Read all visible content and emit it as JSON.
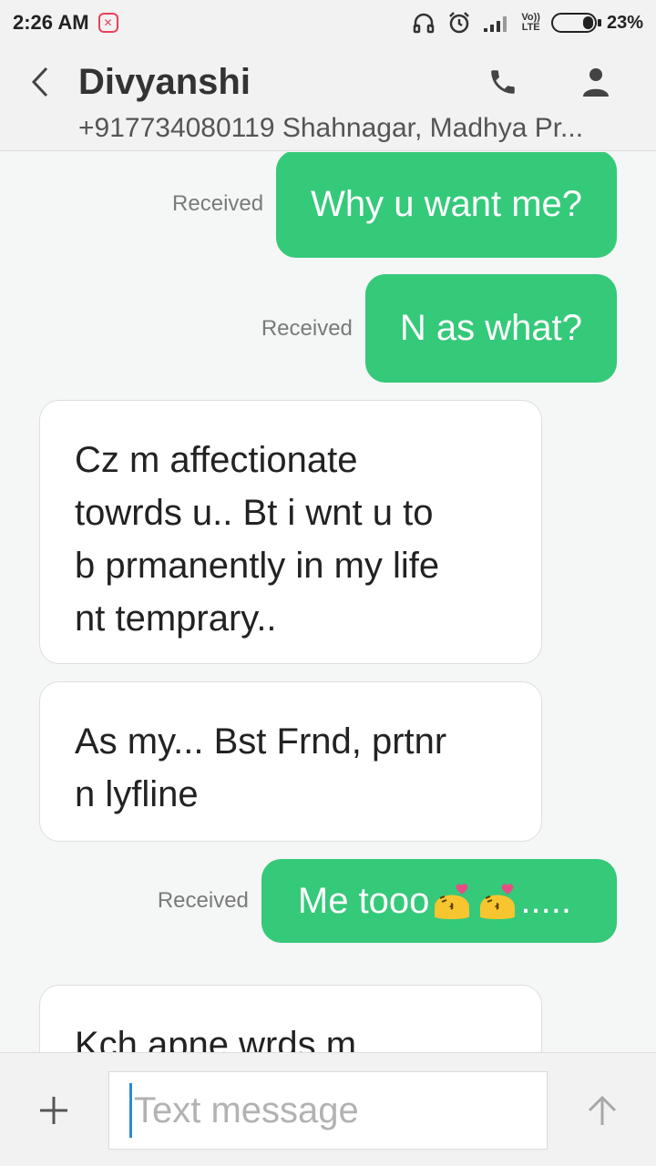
{
  "status_bar": {
    "time": "2:26 AM",
    "network": "VoLTE",
    "lte_top": "Vo))",
    "lte_bottom": "LTE",
    "battery_percent": "23%",
    "battery_level": 0.23
  },
  "header": {
    "contact_name": "Divyanshi",
    "contact_sub": "+917734080119 Shahnagar, Madhya Pr..."
  },
  "messages": [
    {
      "direction": "sent",
      "status": "Received",
      "text": "Why u want me?"
    },
    {
      "direction": "sent",
      "status": "Received",
      "text": "N as what?"
    },
    {
      "direction": "received",
      "lines": [
        "Cz m affectionate",
        "towrds u.. Bt i wnt u to",
        "b prmanently in my life",
        "nt temprary.."
      ]
    },
    {
      "direction": "received",
      "lines": [
        "As my... Bst Frnd, prtnr",
        "n lyfline"
      ]
    },
    {
      "direction": "sent",
      "status": "Received",
      "text_before": "Me tooo",
      "emojis": [
        "kissing-heart-emoji",
        "kissing-heart-emoji"
      ],
      "text_after": "....."
    },
    {
      "direction": "received",
      "lines": [
        "Kch apne wrds m"
      ]
    }
  ],
  "composer": {
    "placeholder": "Text message"
  },
  "colors": {
    "sent_bubble": "#35c97a",
    "received_bubble": "#ffffff",
    "background": "#f5f6f6",
    "cursor": "#2a8ad8"
  }
}
